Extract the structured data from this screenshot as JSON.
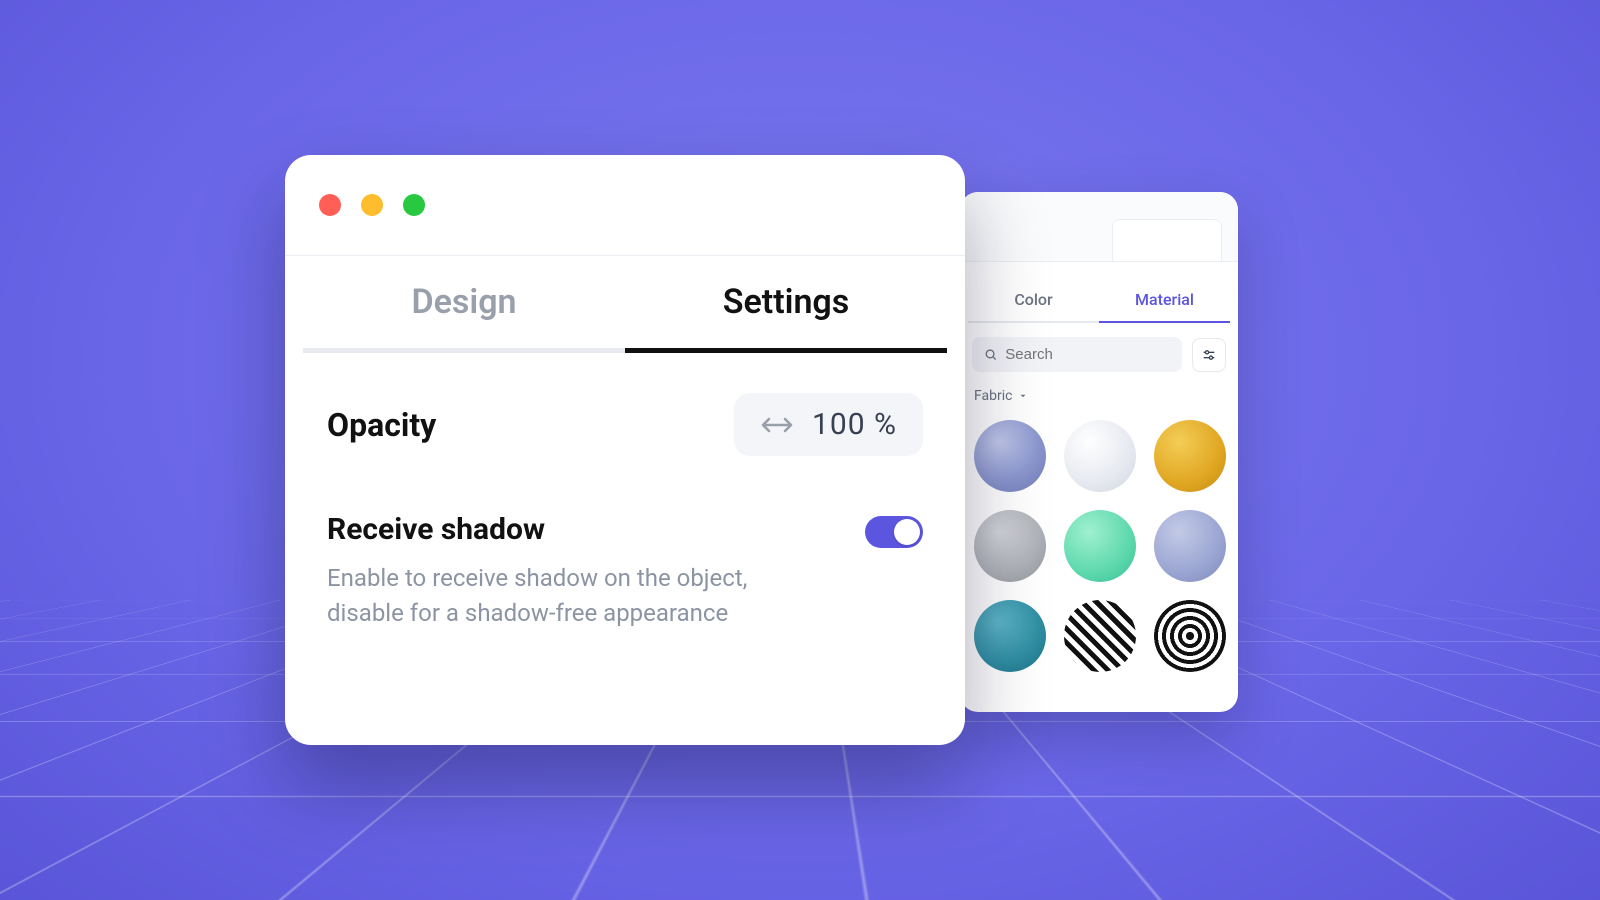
{
  "front": {
    "tabs": {
      "design": "Design",
      "settings": "Settings",
      "active": "settings"
    },
    "opacity": {
      "label": "Opacity",
      "value": "100 %"
    },
    "receive_shadow": {
      "title": "Receive shadow",
      "desc": "Enable to receive shadow on the object, disable for a shadow-free appearance",
      "on": true
    }
  },
  "back": {
    "tabs": {
      "color": "Color",
      "material": "Material",
      "active": "material"
    },
    "search": {
      "placeholder": "Search"
    },
    "category": {
      "label": "Fabric"
    },
    "swatches": [
      "fabric-blue",
      "fabric-white",
      "fabric-gold",
      "fabric-grey",
      "fabric-mint",
      "fabric-slate",
      "fabric-teal",
      "fabric-houndstooth",
      "fabric-stripe"
    ]
  }
}
